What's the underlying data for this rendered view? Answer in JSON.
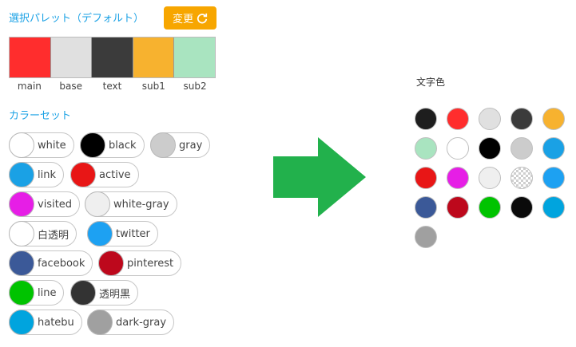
{
  "palette": {
    "title": "選択パレット（デフォルト）",
    "change_label": "変更",
    "swatches": [
      {
        "label": "main",
        "color": "#ff2d2d"
      },
      {
        "label": "base",
        "color": "#e0e0e0"
      },
      {
        "label": "text",
        "color": "#3b3b3b"
      },
      {
        "label": "sub1",
        "color": "#f7b22f"
      },
      {
        "label": "sub2",
        "color": "#a9e4c0"
      }
    ]
  },
  "colorset": {
    "title": "カラーセット",
    "items": [
      {
        "label": "white",
        "color": "#ffffff"
      },
      {
        "label": "black",
        "color": "#000000"
      },
      {
        "label": "gray",
        "color": "#cccccc"
      },
      {
        "label": "link",
        "color": "#1aa1e5"
      },
      {
        "label": "active",
        "color": "#e81616"
      },
      {
        "label": "visited",
        "color": "#e61ee6"
      },
      {
        "label": "white-gray",
        "color": "#efefef"
      },
      {
        "label": "白透明",
        "color": "#ffffff"
      },
      {
        "label": "twitter",
        "color": "#1da1f2"
      },
      {
        "label": "facebook",
        "color": "#3b5998"
      },
      {
        "label": "pinterest",
        "color": "#bd081c"
      },
      {
        "label": "line",
        "color": "#00c300"
      },
      {
        "label": "透明黒",
        "color": "#333333"
      },
      {
        "label": "hatebu",
        "color": "#00a4de"
      },
      {
        "label": "dark-gray",
        "color": "#a0a0a0"
      }
    ]
  },
  "arrow_color": "#22b14c",
  "text_color_panel": {
    "title": "文字色",
    "colors": [
      "#1e1e1e",
      "#ff2d2d",
      "#e0e0e0",
      "#3b3b3b",
      "#f7b22f",
      "#a9e4c0",
      "#ffffff",
      "#000000",
      "#cccccc",
      "#1aa1e5",
      "#e81616",
      "#e61ee6",
      "#efefef",
      "transparent",
      "#1da1f2",
      "#3b5998",
      "#bd081c",
      "#00c300",
      "#0a0a0a",
      "#00a4de",
      "#a0a0a0"
    ]
  }
}
